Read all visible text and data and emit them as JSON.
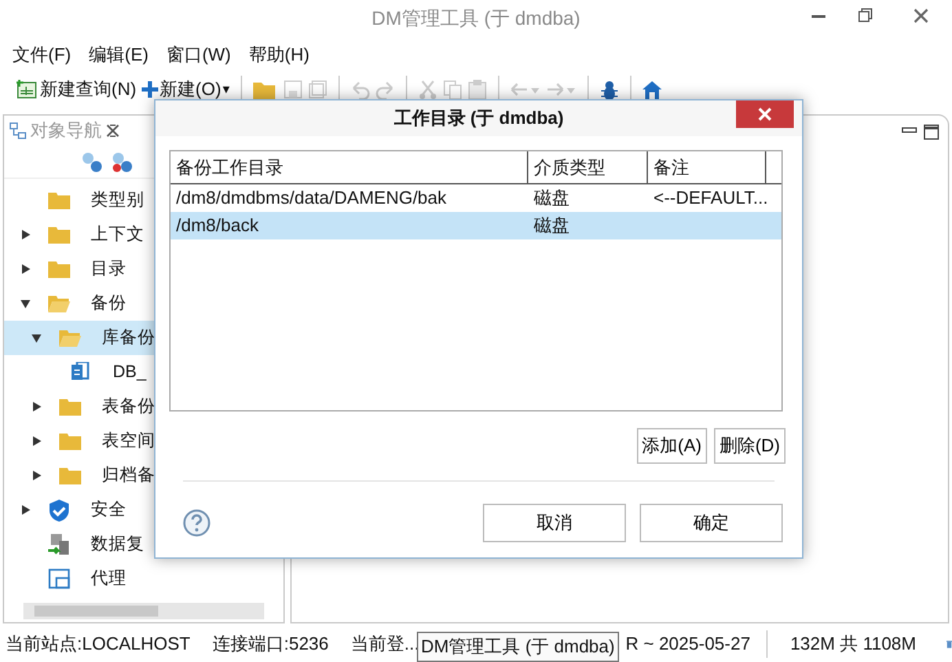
{
  "window": {
    "title": "DM管理工具 (于 dmdba)"
  },
  "menu": [
    "文件(F)",
    "编辑(E)",
    "窗口(W)",
    "帮助(H)"
  ],
  "toolbar": {
    "new_query": "新建查询(N)",
    "new": "新建(O)",
    "new_caret": "▾"
  },
  "navigator": {
    "tab": "对象导航",
    "items": [
      {
        "label": "类型别",
        "kind": "folder",
        "has_arrow": false,
        "selected": false
      },
      {
        "label": "上下文",
        "kind": "folder",
        "has_arrow": true,
        "expanded": false,
        "selected": false
      },
      {
        "label": "目录",
        "kind": "folder",
        "has_arrow": true,
        "expanded": false,
        "selected": false
      },
      {
        "label": "备份",
        "kind": "folder",
        "has_arrow": true,
        "expanded": true,
        "selected": false,
        "children": [
          {
            "label": "库备份",
            "kind": "folder",
            "has_arrow": true,
            "expanded": true,
            "selected": true,
            "children": [
              {
                "label": "DB_",
                "kind": "backup",
                "has_arrow": false,
                "selected": false
              }
            ]
          },
          {
            "label": "表备份",
            "kind": "folder",
            "has_arrow": true,
            "expanded": false,
            "selected": false
          },
          {
            "label": "表空间",
            "kind": "folder",
            "has_arrow": true,
            "expanded": false,
            "selected": false
          },
          {
            "label": "归档备",
            "kind": "folder",
            "has_arrow": true,
            "expanded": false,
            "selected": false
          }
        ]
      },
      {
        "label": "安全",
        "kind": "shield",
        "has_arrow": true,
        "expanded": false,
        "selected": false
      },
      {
        "label": "数据复",
        "kind": "replication",
        "has_arrow": false,
        "selected": false
      },
      {
        "label": "代理",
        "kind": "agent",
        "has_arrow": false,
        "selected": false
      }
    ]
  },
  "dialog": {
    "title": "工作目录 (于 dmdba)",
    "columns": [
      "备份工作目录",
      "介质类型",
      "备注"
    ],
    "rows": [
      {
        "cells": [
          "/dm8/dmdbms/data/DAMENG/bak",
          "磁盘",
          "<--DEFAULT..."
        ],
        "selected": false
      },
      {
        "cells": [
          "/dm8/back",
          "磁盘",
          ""
        ],
        "selected": true
      }
    ],
    "table_buttons": [
      "添加(A)",
      "删除(D)"
    ],
    "buttons": [
      "取消",
      "确定"
    ]
  },
  "status_bar": {
    "items": [
      "当前站点:LOCALHOST",
      "连接端口:5236",
      "当前登...",
      "R ~ 2025-05-27"
    ],
    "tooltip": "DM管理工具 (于 dmdba)",
    "memory": "132M 共 1108M"
  }
}
